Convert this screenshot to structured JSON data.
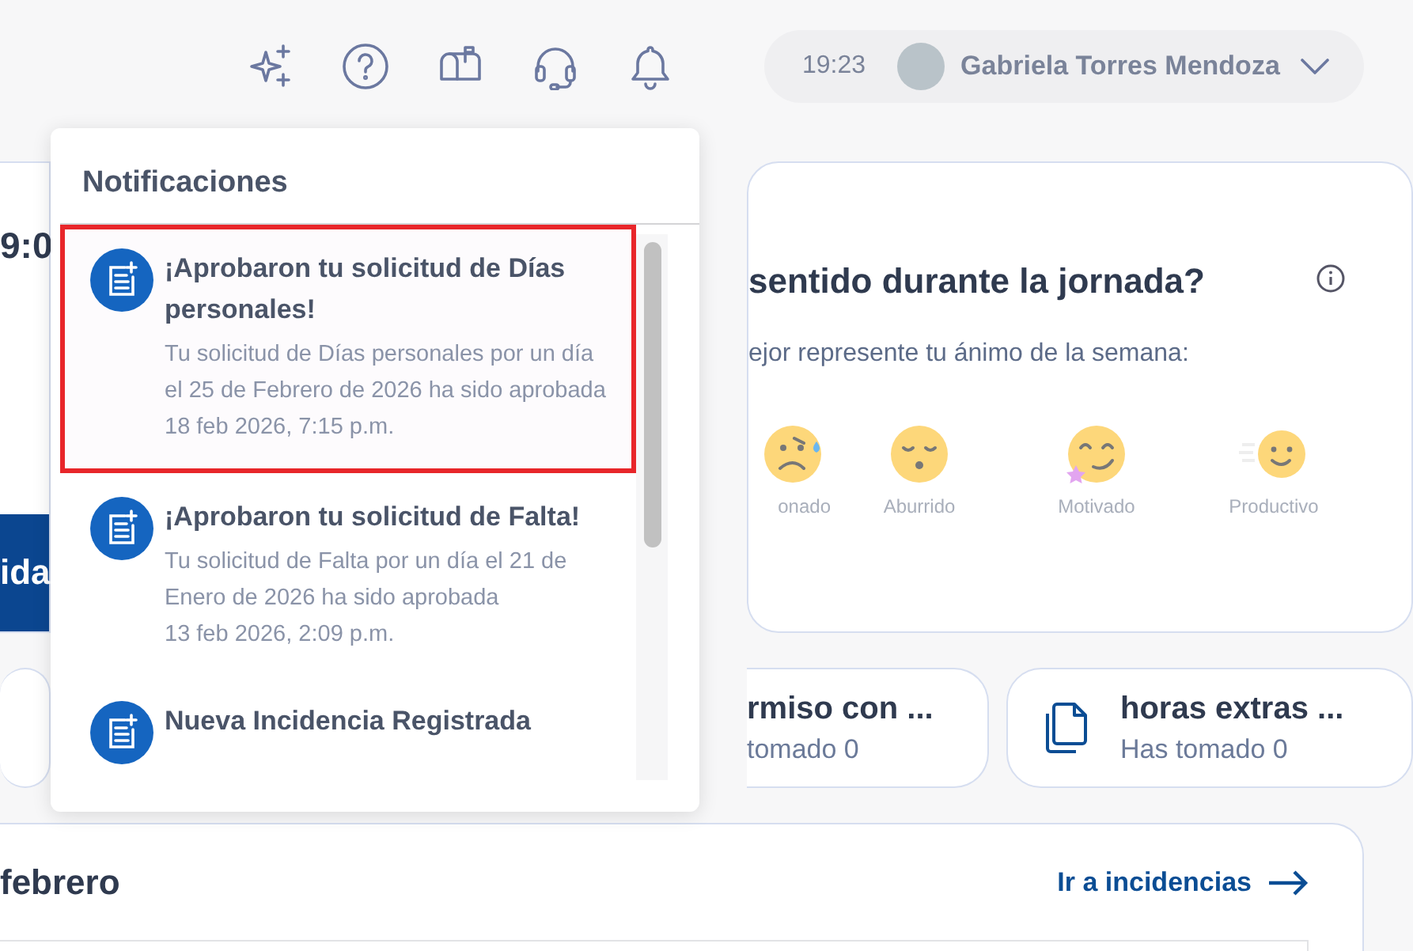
{
  "topbar": {
    "time": "19:23",
    "user_name": "Gabriela Torres Mendoza"
  },
  "dashboard": {
    "clock_partial": "9:0",
    "button_partial": "ida",
    "mood_card": {
      "title": "sentido durante la jornada?",
      "subtitle": "ejor represente tu ánimo de la semana:",
      "moods": [
        {
          "kind": "stressed",
          "label": "onado"
        },
        {
          "kind": "bored",
          "label": "Aburrido"
        },
        {
          "kind": "motivated",
          "label": "Motivado"
        },
        {
          "kind": "productive",
          "label": "Productivo"
        }
      ]
    },
    "chips": [
      {
        "kind": "text",
        "title": "rmiso con ...",
        "subtitle": "tomado 0"
      },
      {
        "kind": "icon",
        "title": "horas extras ...",
        "subtitle": "Has tomado 0"
      }
    ],
    "incidents": {
      "title": "febrero",
      "link": "Ir a incidencias"
    }
  },
  "notifications": {
    "title": "Notificaciones",
    "items": [
      {
        "title": "¡Aprobaron tu solicitud de Días personales!",
        "body": "Tu solicitud de Días personales por un día el 25 de Febrero de 2026 ha sido aprobada",
        "time": "18 feb 2026, 7:15 p.m.",
        "highlighted": true
      },
      {
        "title": "¡Aprobaron tu solicitud de Falta!",
        "body": "Tu solicitud de Falta por un día el 21 de Enero de 2026 ha sido aprobada",
        "time": "13 feb 2026, 2:09 p.m.",
        "highlighted": false
      },
      {
        "title": "Nueva Incidencia Registrada",
        "highlighted": false
      }
    ]
  }
}
